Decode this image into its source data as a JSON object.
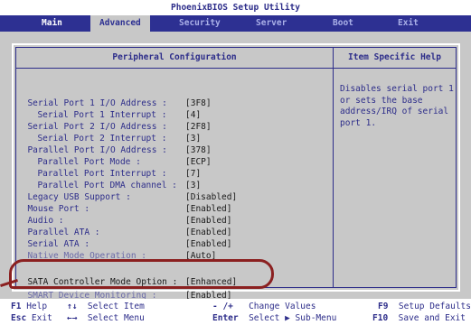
{
  "window": {
    "title": "PhoenixBIOS Setup Utility"
  },
  "menu": {
    "tabs": [
      {
        "label": "Main"
      },
      {
        "label": "Advanced"
      },
      {
        "label": "Security"
      },
      {
        "label": "Server"
      },
      {
        "label": "Boot"
      },
      {
        "label": "Exit"
      }
    ],
    "active": "Advanced"
  },
  "panel": {
    "title": "Peripheral Configuration",
    "help_title": "Item Specific Help",
    "help_text": "Disables serial port 1 or sets the base address/IRQ of serial port 1."
  },
  "settings": [
    {
      "label": "Serial Port 1 I/O Address :",
      "value": "[3F8]"
    },
    {
      "label": "Serial Port 1 Interrupt :",
      "value": "[4]"
    },
    {
      "label": "Serial Port 2 I/O Address :",
      "value": "[2F8]"
    },
    {
      "label": "Serial Port 2 Interrupt :",
      "value": "[3]"
    },
    {
      "label": "Parallel Port I/O Address :",
      "value": "[378]"
    },
    {
      "label": "Parallel Port Mode :",
      "value": "[ECP]"
    },
    {
      "label": "Parallel Port Interrupt :",
      "value": "[7]"
    },
    {
      "label": "Parallel Port DMA channel :",
      "value": "[3]"
    },
    {
      "label": "Legacy USB Support :",
      "value": "[Disabled]"
    },
    {
      "label": "Mouse Port :",
      "value": "[Enabled]"
    },
    {
      "label": "Audio :",
      "value": "[Enabled]"
    },
    {
      "label": "Parallel ATA :",
      "value": "[Enabled]"
    },
    {
      "label": "Serial ATA :",
      "value": "[Enabled]"
    },
    {
      "label": "Native Mode Operation :",
      "value": "[Auto]"
    },
    {
      "label": "SATA Controller Mode Option :",
      "value": "[Enhanced]"
    },
    {
      "label": "SMART Device Monitoring :",
      "value": "[Enabled]"
    }
  ],
  "footer": {
    "f1_key": "F1",
    "f1_text": "Help",
    "updown_key": "↑↓",
    "updown_text": "Select Item",
    "minus_key": "- /+",
    "minus_text": "Change Values",
    "f9_key": "F9",
    "f9_text": "Setup Defaults",
    "esc_key": "Esc",
    "esc_text": "Exit",
    "lr_key": "←→",
    "lr_text": "Select Menu",
    "enter_key": "Enter",
    "enter_text": "Select ▶ Sub-Menu",
    "f10_key": "F10",
    "f10_text": "Save and Exit"
  },
  "colors": {
    "menu_bg": "#2d3092",
    "panel_bg": "#c8c8c8",
    "text": "#2d2d8a",
    "highlight_circle": "#8b2020"
  }
}
